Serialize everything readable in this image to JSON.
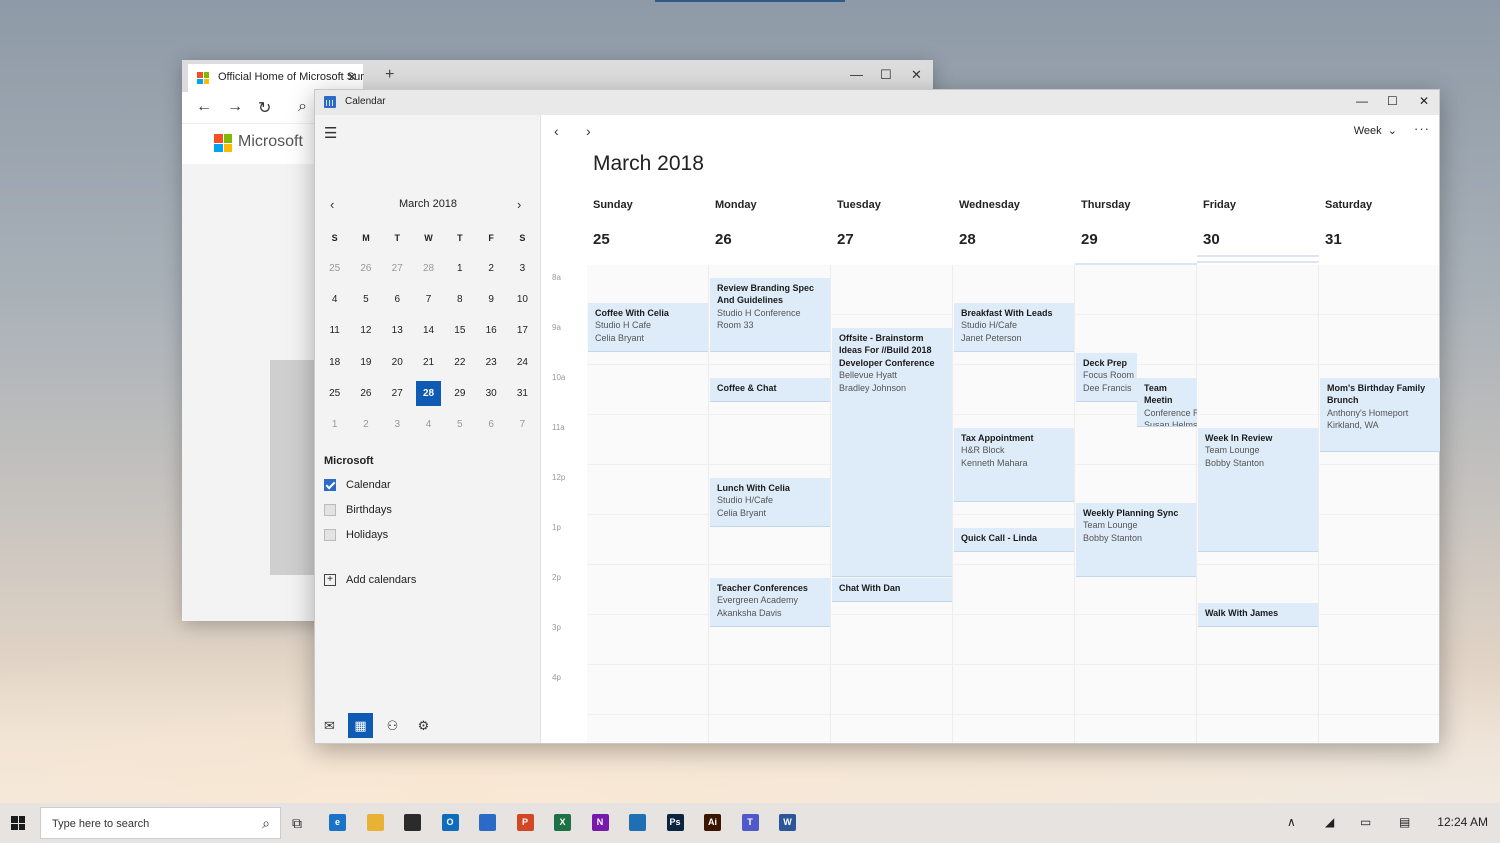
{
  "browser": {
    "tab_title": "Official Home of Microsoft Sur",
    "tab_close": "✕",
    "new_tab": "+",
    "site_name": "Microsoft"
  },
  "calendar_window": {
    "title": "Calendar"
  },
  "mini_calendar": {
    "title": "March 2018",
    "weekdays": [
      "S",
      "M",
      "T",
      "W",
      "T",
      "F",
      "S"
    ],
    "days": [
      {
        "d": "25",
        "other": true
      },
      {
        "d": "26",
        "other": true
      },
      {
        "d": "27",
        "other": true
      },
      {
        "d": "28",
        "other": true
      },
      {
        "d": "1"
      },
      {
        "d": "2"
      },
      {
        "d": "3"
      },
      {
        "d": "4"
      },
      {
        "d": "5"
      },
      {
        "d": "6"
      },
      {
        "d": "7"
      },
      {
        "d": "8"
      },
      {
        "d": "9"
      },
      {
        "d": "10"
      },
      {
        "d": "11"
      },
      {
        "d": "12"
      },
      {
        "d": "13"
      },
      {
        "d": "14"
      },
      {
        "d": "15"
      },
      {
        "d": "16"
      },
      {
        "d": "17"
      },
      {
        "d": "18"
      },
      {
        "d": "19"
      },
      {
        "d": "20"
      },
      {
        "d": "21"
      },
      {
        "d": "22"
      },
      {
        "d": "23"
      },
      {
        "d": "24"
      },
      {
        "d": "25"
      },
      {
        "d": "26"
      },
      {
        "d": "27"
      },
      {
        "d": "28",
        "today": true
      },
      {
        "d": "29"
      },
      {
        "d": "30"
      },
      {
        "d": "31"
      },
      {
        "d": "1",
        "other": true
      },
      {
        "d": "2",
        "other": true
      },
      {
        "d": "3",
        "other": true
      },
      {
        "d": "4",
        "other": true
      },
      {
        "d": "5",
        "other": true
      },
      {
        "d": "6",
        "other": true
      },
      {
        "d": "7",
        "other": true
      }
    ]
  },
  "sidebar": {
    "account": "Microsoft",
    "calendars": [
      {
        "label": "Calendar",
        "checked": true
      },
      {
        "label": "Birthdays",
        "checked": false
      },
      {
        "label": "Holidays",
        "checked": false
      }
    ],
    "add_calendars": "Add calendars"
  },
  "main": {
    "view": "Week",
    "more": "···",
    "month_title": "March 2018",
    "days": [
      {
        "name": "Sunday",
        "date": "25"
      },
      {
        "name": "Monday",
        "date": "26"
      },
      {
        "name": "Tuesday",
        "date": "27"
      },
      {
        "name": "Wednesday",
        "date": "28"
      },
      {
        "name": "Thursday",
        "date": "29"
      },
      {
        "name": "Friday",
        "date": "30"
      },
      {
        "name": "Saturday",
        "date": "31"
      }
    ],
    "hours": [
      "8a",
      "9a",
      "10a",
      "11a",
      "12p",
      "1p",
      "2p",
      "3p",
      "4p"
    ],
    "events": [
      {
        "day": 0,
        "start": 8.5,
        "end": 9.5,
        "title": "Coffee With Celia",
        "lines": [
          "Studio H Cafe",
          "Celia Bryant"
        ]
      },
      {
        "day": 1,
        "start": 8.0,
        "end": 9.5,
        "title": "Review Branding Spec And Guidelines",
        "lines": [
          "Studio H Conference",
          "Room 33"
        ]
      },
      {
        "day": 1,
        "start": 10.0,
        "end": 10.5,
        "title": "Coffee & Chat",
        "lines": []
      },
      {
        "day": 1,
        "start": 12.0,
        "end": 13.0,
        "title": "Lunch With Celia",
        "lines": [
          "Studio H/Cafe",
          "Celia Bryant"
        ]
      },
      {
        "day": 1,
        "start": 14.0,
        "end": 15.0,
        "title": "Teacher Conferences",
        "lines": [
          "Evergreen Academy",
          "Akanksha Davis"
        ]
      },
      {
        "day": 2,
        "start": 9.0,
        "end": 14.0,
        "title": "Offsite - Brainstorm Ideas For //Build 2018 Developer Conference",
        "lines": [
          "Bellevue Hyatt",
          "Bradley Johnson"
        ]
      },
      {
        "day": 2,
        "start": 14.0,
        "end": 14.5,
        "title": "Chat With Dan",
        "lines": []
      },
      {
        "day": 3,
        "start": 8.5,
        "end": 9.5,
        "title": "Breakfast With Leads",
        "lines": [
          "Studio H/Cafe",
          "Janet Peterson"
        ]
      },
      {
        "day": 3,
        "start": 11.0,
        "end": 12.5,
        "title": "Tax Appointment",
        "lines": [
          "H&R Block",
          "Kenneth Mahara"
        ]
      },
      {
        "day": 3,
        "start": 13.0,
        "end": 13.5,
        "title": "Quick Call - Linda",
        "lines": []
      },
      {
        "day": 4,
        "start": 9.5,
        "end": 10.5,
        "title": "Deck Prep",
        "lines": [
          "Focus Room",
          "Dee Francis"
        ],
        "split": "left"
      },
      {
        "day": 4,
        "start": 10.0,
        "end": 11.0,
        "title": "Team Meetin",
        "lines": [
          "Conference R",
          "Susan Helms"
        ],
        "split": "right"
      },
      {
        "day": 4,
        "start": 12.5,
        "end": 14.0,
        "title": "Weekly Planning Sync",
        "lines": [
          "Team Lounge",
          "Bobby Stanton"
        ]
      },
      {
        "day": 5,
        "start": 11.0,
        "end": 13.5,
        "title": "Week In Review",
        "lines": [
          "Team Lounge",
          "Bobby Stanton"
        ]
      },
      {
        "day": 5,
        "start": 14.5,
        "end": 15.0,
        "title": "Walk With James",
        "lines": []
      },
      {
        "day": 6,
        "start": 10.0,
        "end": 11.5,
        "title": "Mom's Birthday Family Brunch",
        "lines": [
          "Anthony's Homeport",
          "Kirkland, WA"
        ]
      }
    ]
  },
  "taskbar": {
    "search_placeholder": "Type here to search",
    "clock": "12:24 AM",
    "apps": [
      {
        "name": "edge-icon",
        "color": "#1a73c8",
        "glyph": "e"
      },
      {
        "name": "file-explorer-icon",
        "color": "#e8b234",
        "glyph": ""
      },
      {
        "name": "store-icon",
        "color": "#2b2b2b",
        "glyph": ""
      },
      {
        "name": "outlook-icon",
        "color": "#0f6cbd",
        "glyph": "O"
      },
      {
        "name": "calendar-app-icon",
        "color": "#2b6bc7",
        "glyph": ""
      },
      {
        "name": "powerpoint-icon",
        "color": "#d24726",
        "glyph": "P"
      },
      {
        "name": "excel-icon",
        "color": "#1e7145",
        "glyph": "X"
      },
      {
        "name": "onenote-icon",
        "color": "#7719aa",
        "glyph": "N"
      },
      {
        "name": "photos-icon",
        "color": "#1f6fb5",
        "glyph": ""
      },
      {
        "name": "photoshop-icon",
        "color": "#0b2440",
        "glyph": "Ps"
      },
      {
        "name": "illustrator-icon",
        "color": "#3a1500",
        "glyph": "Ai"
      },
      {
        "name": "teams-icon",
        "color": "#5059c9",
        "glyph": "T"
      },
      {
        "name": "word-icon",
        "color": "#2b579a",
        "glyph": "W"
      }
    ]
  }
}
